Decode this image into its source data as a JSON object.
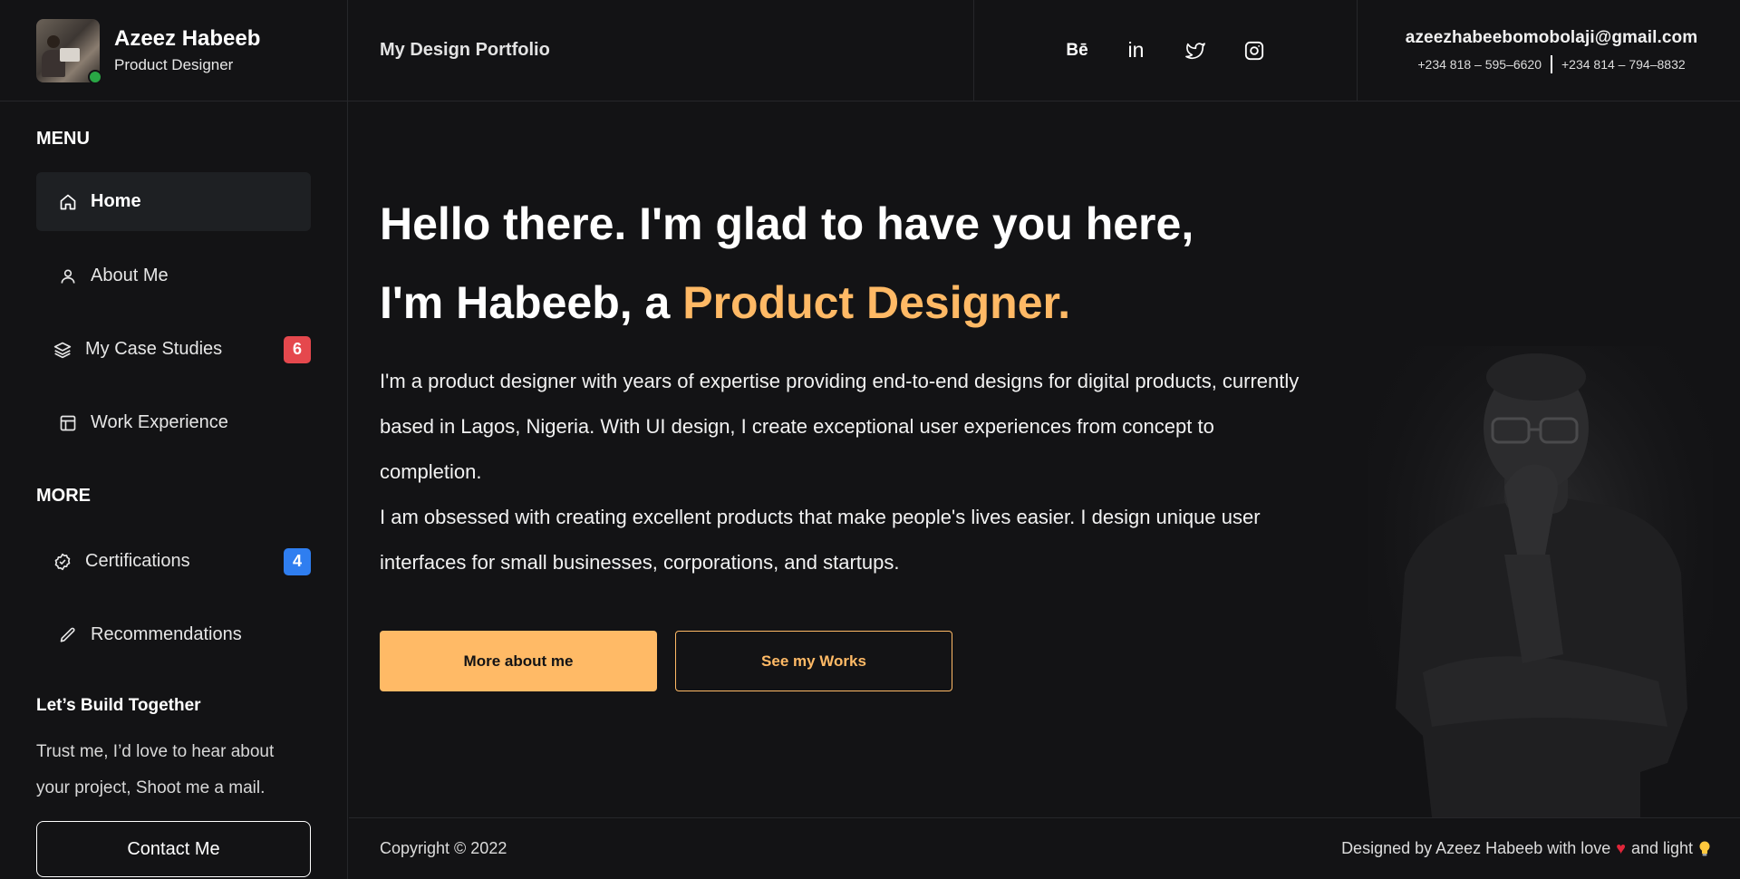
{
  "profile": {
    "name": "Azeez Habeeb",
    "role": "Product Designer",
    "status_color": "#29a745"
  },
  "header": {
    "portfolio_title": "My Design Portfolio",
    "socials": [
      {
        "icon": "behance-icon",
        "label": "Bē"
      },
      {
        "icon": "linkedin-icon",
        "label": "in"
      },
      {
        "icon": "twitter-icon",
        "label": ""
      },
      {
        "icon": "instagram-icon",
        "label": ""
      }
    ],
    "email": "azeezhabeebomobolaji@gmail.com",
    "phone_1": "+234 818 – 595–6620",
    "phone_2": "+234 814 – 794–8832"
  },
  "sidebar": {
    "menu_title": "MENU",
    "items": [
      {
        "label": "Home",
        "icon": "home-icon",
        "active": true
      },
      {
        "label": "About Me",
        "icon": "user-icon"
      },
      {
        "label": "My Case Studies",
        "icon": "layers-icon",
        "badge": "6",
        "badge_color": "#e5484d"
      },
      {
        "label": "Work Experience",
        "icon": "layout-icon"
      }
    ],
    "more_title": "MORE",
    "more_items": [
      {
        "label": "Certifications",
        "icon": "badge-check-icon",
        "badge": "4",
        "badge_color": "#2f7ef0"
      },
      {
        "label": "Recommendations",
        "icon": "pencil-icon"
      }
    ],
    "build_title": "Let’s Build Together",
    "build_text": "Trust me, I’d love to hear about your project, Shoot me a mail.",
    "contact_label": "Contact Me"
  },
  "hero": {
    "line1": "Hello there. I'm glad to have you here,",
    "line2_prefix": "I'm Habeeb, a ",
    "line2_accent": "Product Designer.",
    "paragraph_1": "I'm a product designer with years of expertise providing end-to-end designs for digital products, currently based in Lagos, Nigeria. With UI design, I create exceptional user experiences from concept to completion.",
    "paragraph_2": "I am obsessed with creating excellent products that make people's lives easier. I design unique user interfaces for small businesses, corporations, and startups.",
    "primary_button": "More about me",
    "secondary_button": "See my Works",
    "accent_color": "#ffb965"
  },
  "footer": {
    "copyright": "Copyright © 2022",
    "credit_prefix": "Designed by Azeez Habeeb with love",
    "credit_middle": "and light"
  }
}
